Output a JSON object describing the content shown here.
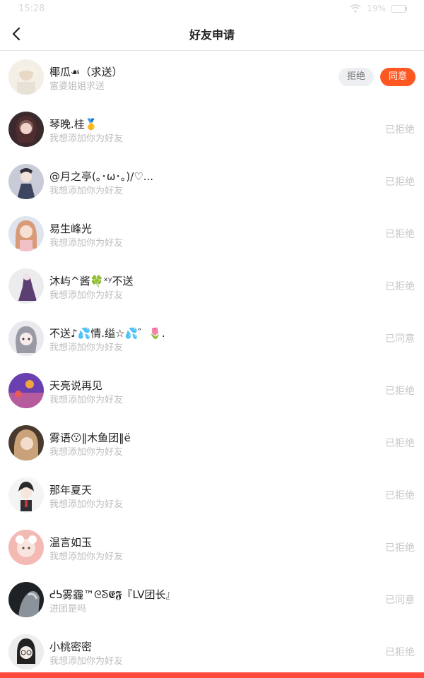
{
  "status_bar": {
    "time": "15:28",
    "battery": "19%"
  },
  "header": {
    "title": "好友申请"
  },
  "colors": {
    "accent": "#ff5722",
    "bottom_bar": "#ff4a3d"
  },
  "requests": [
    {
      "name": "椰瓜☙（求送）",
      "message": "富婆姐姐求送",
      "status": "pending",
      "reject_label": "拒绝",
      "accept_label": "同意"
    },
    {
      "name": "琴晚.桂🥇",
      "message": "我想添加你为好友",
      "status": "已拒绝"
    },
    {
      "name": "@月之亭(｡･ω･｡)/♡...",
      "message": "我想添加你为好友",
      "status": "已拒绝"
    },
    {
      "name": "易生峰光",
      "message": "我想添加你为好友",
      "status": "已拒绝"
    },
    {
      "name": "沐屿^酱🍀ˣʸ不送",
      "message": "我想添加你为好友",
      "status": "已拒绝"
    },
    {
      "name": "不送♪💦情.缢☆💦゛🌷.",
      "message": "我想添加你为好友",
      "status": "已同意"
    },
    {
      "name": "天亮说再见",
      "message": "我想添加你为好友",
      "status": "已拒绝"
    },
    {
      "name": "雾语😗‖木鱼团‖ë",
      "message": "我想添加你为好友",
      "status": "已拒绝"
    },
    {
      "name": "那年夏天",
      "message": "我想添加你为好友",
      "status": "已拒绝"
    },
    {
      "name": "温言如玉",
      "message": "我想添加你为好友",
      "status": "已拒绝"
    },
    {
      "name": "ᕍᕊ雾霾™ᘓᘕ𝕰𝕱『LV团长』",
      "message": "进团是吗",
      "status": "已同意"
    },
    {
      "name": "小桃密密",
      "message": "我想添加你为好友",
      "status": "已拒绝"
    }
  ]
}
